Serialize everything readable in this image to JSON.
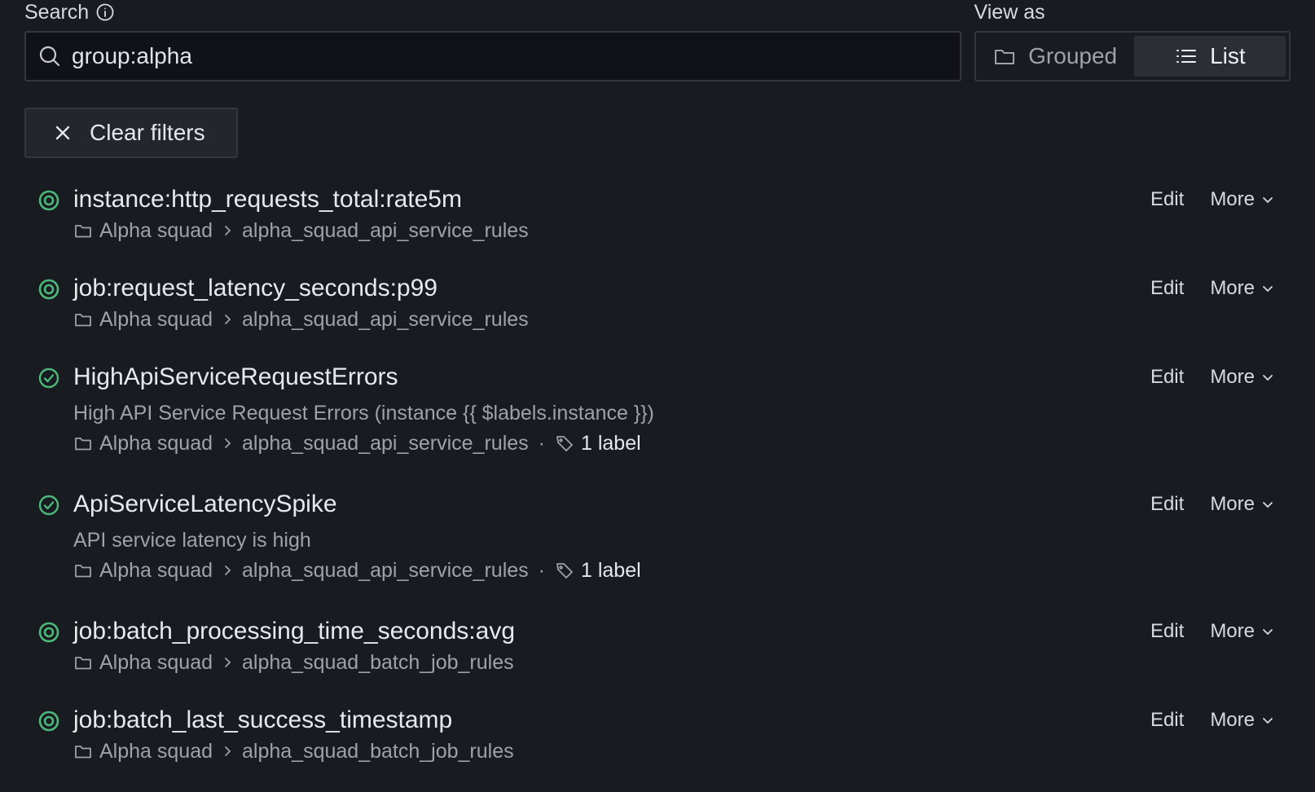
{
  "search": {
    "label": "Search",
    "value": "group:alpha"
  },
  "view_as": {
    "label": "View as",
    "options": [
      {
        "label": "Grouped",
        "active": false
      },
      {
        "label": "List",
        "active": true
      }
    ]
  },
  "clear_filters": {
    "label": "Clear filters"
  },
  "colors": {
    "status_green": "#4cb97a",
    "background": "#181b1f"
  },
  "rules": [
    {
      "title": "instance:http_requests_total:rate5m",
      "status_icon": "recording-rule-icon",
      "summary": "",
      "folder": "Alpha squad",
      "group": "alpha_squad_api_service_rules",
      "labels": "",
      "edit": "Edit",
      "more": "More"
    },
    {
      "title": "job:request_latency_seconds:p99",
      "status_icon": "recording-rule-icon",
      "summary": "",
      "folder": "Alpha squad",
      "group": "alpha_squad_api_service_rules",
      "labels": "",
      "edit": "Edit",
      "more": "More"
    },
    {
      "title": "HighApiServiceRequestErrors",
      "status_icon": "check-circle-icon",
      "summary": "High API Service Request Errors (instance {{ $labels.instance }})",
      "folder": "Alpha squad",
      "group": "alpha_squad_api_service_rules",
      "labels": "1 label",
      "edit": "Edit",
      "more": "More"
    },
    {
      "title": "ApiServiceLatencySpike",
      "status_icon": "check-circle-icon",
      "summary": "API service latency is high",
      "folder": "Alpha squad",
      "group": "alpha_squad_api_service_rules",
      "labels": "1 label",
      "edit": "Edit",
      "more": "More"
    },
    {
      "title": "job:batch_processing_time_seconds:avg",
      "status_icon": "recording-rule-icon",
      "summary": "",
      "folder": "Alpha squad",
      "group": "alpha_squad_batch_job_rules",
      "labels": "",
      "edit": "Edit",
      "more": "More"
    },
    {
      "title": "job:batch_last_success_timestamp",
      "status_icon": "recording-rule-icon",
      "summary": "",
      "folder": "Alpha squad",
      "group": "alpha_squad_batch_job_rules",
      "labels": "",
      "edit": "Edit",
      "more": "More"
    }
  ]
}
